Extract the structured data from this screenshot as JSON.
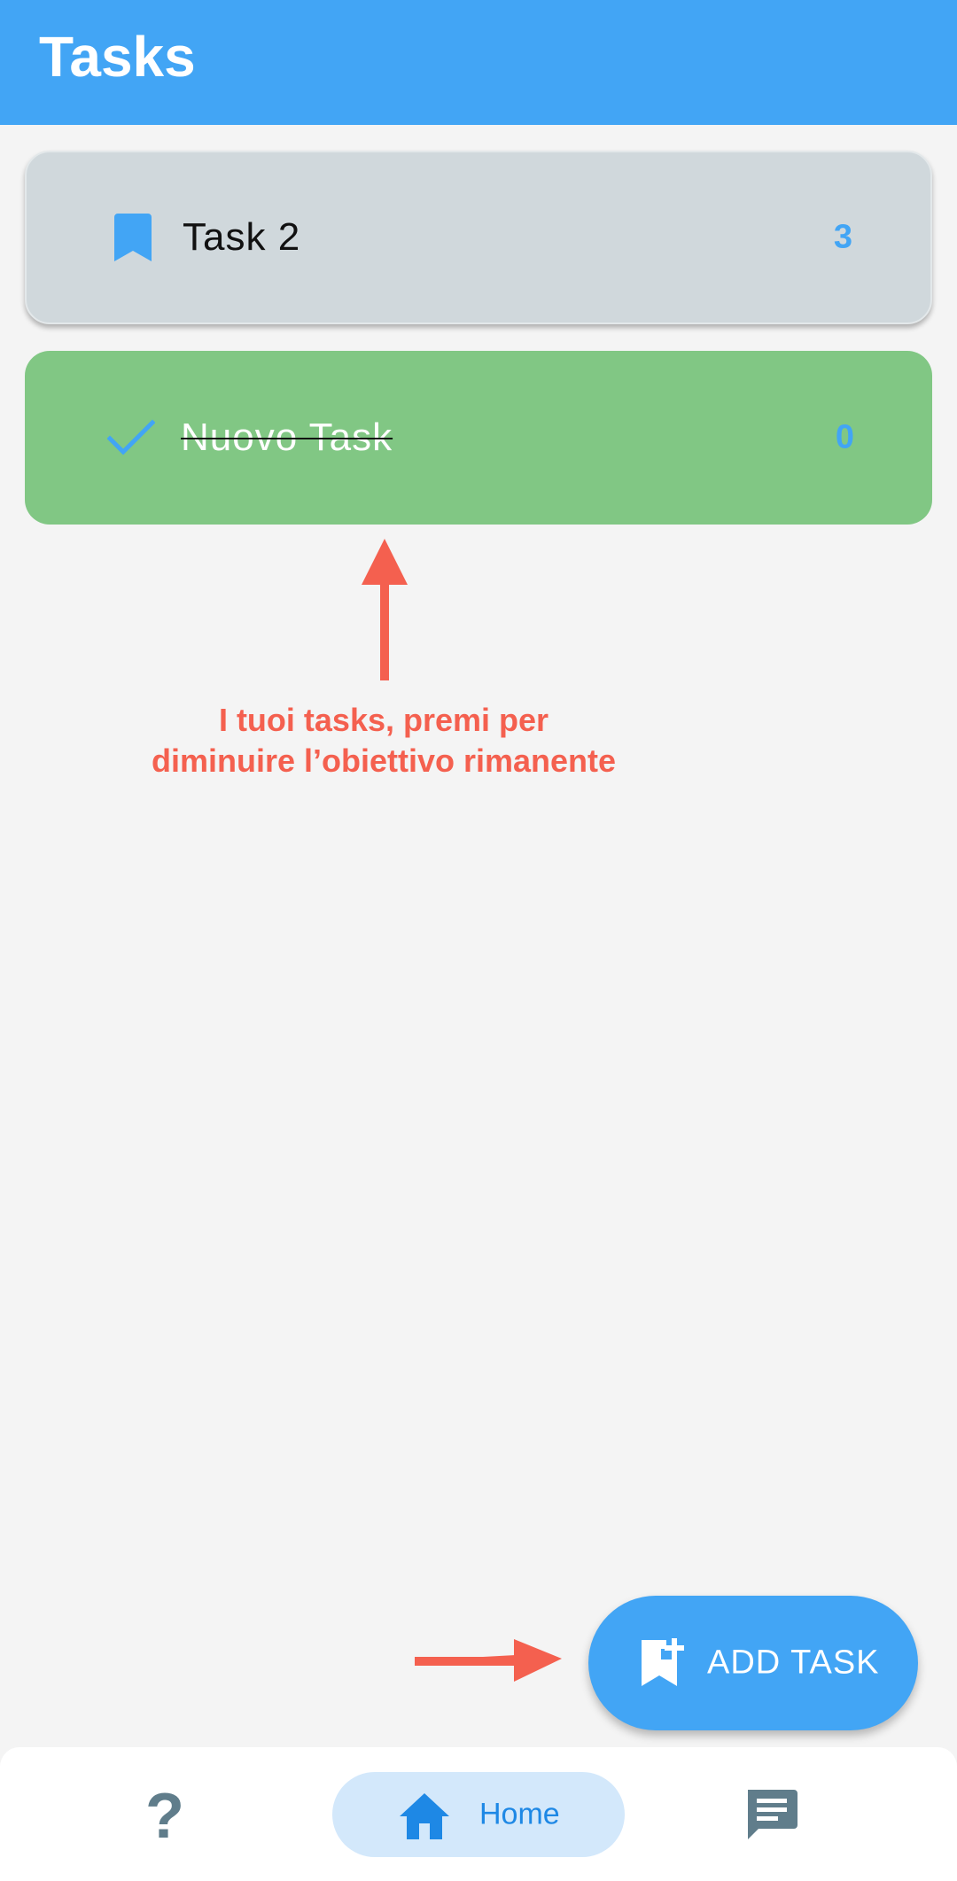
{
  "app_bar": {
    "title": "Tasks"
  },
  "tasks": [
    {
      "label": "Task 2",
      "count": "3",
      "status": "pending",
      "icon": "bookmark-icon"
    },
    {
      "label": "Nuovo Task",
      "count": "0",
      "status": "done",
      "icon": "check-icon"
    }
  ],
  "annotation": {
    "line1": "I tuoi tasks, premi per",
    "line2": "diminuire l’obiettivo rimanente"
  },
  "fab": {
    "label": "ADD TASK",
    "icon": "bookmark-add-icon"
  },
  "bottom_nav": {
    "help_glyph": "?",
    "home_label": "Home",
    "icons": [
      "help-icon",
      "home-icon",
      "chat-icon"
    ]
  },
  "colors": {
    "primary": "#42a5f5",
    "done_card": "#81c784",
    "pending_card": "#d0d8dc",
    "annotation": "#f4604f",
    "background": "#f4f4f4"
  }
}
